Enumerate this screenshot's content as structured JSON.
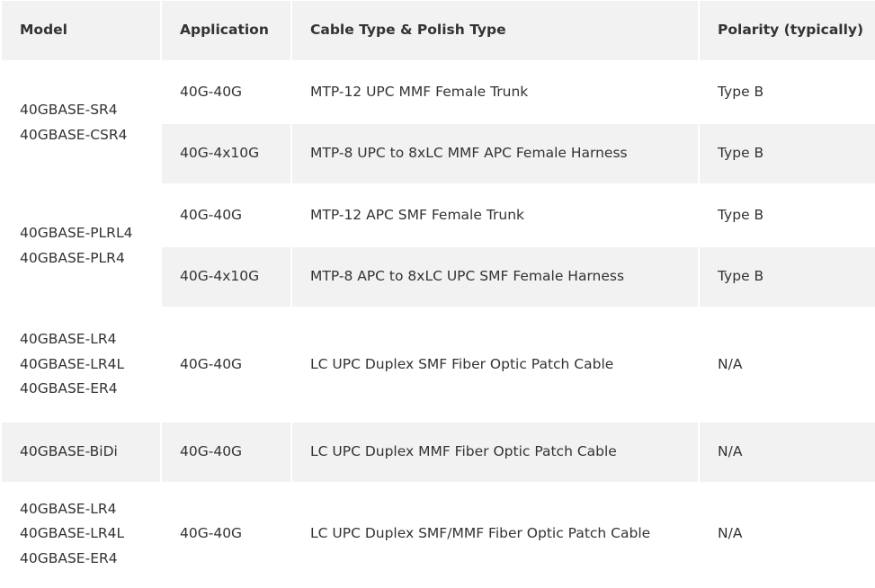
{
  "table": {
    "headers": [
      "Model",
      "Application",
      "Cable Type & Polish Type",
      "Polarity (typically)"
    ],
    "groups": [
      {
        "models": [
          "40GBASE-SR4",
          "40GBASE-CSR4"
        ],
        "rows": [
          {
            "application": "40G-40G",
            "cable": "MTP-12 UPC MMF Female Trunk",
            "polarity": "Type B"
          },
          {
            "application": "40G-4x10G",
            "cable": "MTP-8 UPC to 8xLC MMF APC Female Harness",
            "polarity": "Type B"
          }
        ]
      },
      {
        "models": [
          "40GBASE-PLRL4",
          "40GBASE-PLR4"
        ],
        "rows": [
          {
            "application": "40G-40G",
            "cable": "MTP-12 APC SMF Female Trunk",
            "polarity": "Type B"
          },
          {
            "application": "40G-4x10G",
            "cable": "MTP-8 APC to 8xLC UPC SMF Female Harness",
            "polarity": "Type B"
          }
        ]
      },
      {
        "models": [
          "40GBASE-LR4",
          "40GBASE-LR4L",
          "40GBASE-ER4"
        ],
        "rows": [
          {
            "application": "40G-40G",
            "cable": "LC UPC Duplex SMF Fiber Optic Patch Cable",
            "polarity": "N/A"
          }
        ]
      },
      {
        "models": [
          "40GBASE-BiDi"
        ],
        "rows": [
          {
            "application": "40G-40G",
            "cable": "LC UPC Duplex MMF Fiber Optic Patch Cable",
            "polarity": "N/A"
          }
        ]
      },
      {
        "models": [
          "40GBASE-LR4",
          "40GBASE-LR4L",
          "40GBASE-ER4"
        ],
        "rows": [
          {
            "application": "40G-40G",
            "cable": "LC UPC Duplex SMF/MMF Fiber Optic Patch Cable",
            "polarity": "N/A"
          }
        ]
      }
    ]
  }
}
